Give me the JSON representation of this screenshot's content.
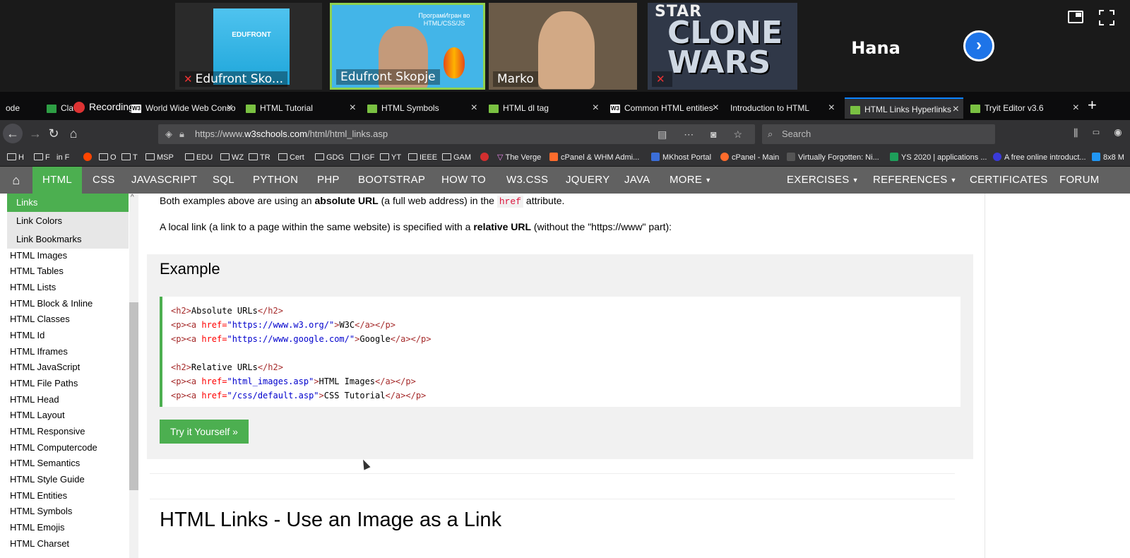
{
  "meeting": {
    "participants": [
      "Edufront Sko...",
      "Edufront Skopje",
      "Marko",
      "",
      "Hana"
    ],
    "tile1_logo": "EDUFRONT",
    "tile2_slide": "ПрограмИгран во HTML/CSS/JS",
    "tile4_star": "STAR",
    "tile4_title": "CLONE WARS",
    "next_icon": "›"
  },
  "tabs": [
    {
      "label": "ode",
      "close": ""
    },
    {
      "label": "Class",
      "close": ""
    },
    {
      "label": "World Wide Web Conso",
      "close": "×"
    },
    {
      "label": "HTML Tutorial",
      "close": "×"
    },
    {
      "label": "HTML Symbols",
      "close": "×"
    },
    {
      "label": "HTML dl tag",
      "close": "×"
    },
    {
      "label": "Common HTML entities",
      "close": "×"
    },
    {
      "label": "Introduction to HTML",
      "close": "×"
    },
    {
      "label": "HTML Links Hyperlinks",
      "close": "×"
    },
    {
      "label": "Tryit Editor v3.6",
      "close": "×"
    }
  ],
  "recording": "Recording",
  "newtab": "+",
  "nav": {
    "url_prefix": "https://www.",
    "url_domain": "w3schools.com",
    "url_path": "/html/html_links.asp",
    "search_placeholder": "Search",
    "url_icons": "▤ ⋯ ◙ ☆",
    "right_icons": "⫼ ▭ ◉"
  },
  "bookmarks": [
    "H",
    "F",
    "in F",
    "",
    "O",
    "T",
    "MSP",
    "EDU",
    "WZ",
    "TR",
    "Cert",
    "GDG",
    "IGF",
    "YT",
    "IEEE",
    "GAM",
    "",
    "The Verge",
    "cPanel & WHM Admi...",
    "MKhost Portal",
    "cPanel - Main",
    "Virtually Forgotten: Ni...",
    "YS 2020 | applications ...",
    "A free online introduct...",
    "8x8 M"
  ],
  "w3nav": [
    "HTML",
    "CSS",
    "JAVASCRIPT",
    "SQL",
    "PYTHON",
    "PHP",
    "BOOTSTRAP",
    "HOW TO",
    "W3.CSS",
    "JQUERY",
    "JAVA",
    "MORE",
    "EXERCISES",
    "REFERENCES",
    "CERTIFICATES",
    "FORUM"
  ],
  "sidebar": {
    "sub": [
      "Links",
      "Link Colors",
      "Link Bookmarks"
    ],
    "items": [
      "HTML Images",
      "HTML Tables",
      "HTML Lists",
      "HTML Block & Inline",
      "HTML Classes",
      "HTML Id",
      "HTML Iframes",
      "HTML JavaScript",
      "HTML File Paths",
      "HTML Head",
      "HTML Layout",
      "HTML Responsive",
      "HTML Computercode",
      "HTML Semantics",
      "HTML Style Guide",
      "HTML Entities",
      "HTML Symbols",
      "HTML Emojis",
      "HTML Charset"
    ]
  },
  "content": {
    "p1_a": "Both examples above are using an ",
    "p1_b": "absolute URL",
    "p1_c": " (a full web address) in the ",
    "p1_code": "href",
    "p1_d": " attribute.",
    "p2_a": "A local link (a link to a page within the same website) is specified with a ",
    "p2_b": "relative URL",
    "p2_c": " (without the \"https://www\" part):",
    "example_title": "Example",
    "code": {
      "l1_open": "<h2>",
      "l1_text": "Absolute URLs",
      "l1_close": "</h2>",
      "l2_url": "\"https://www.w3.org/\"",
      "l2_text": "W3C",
      "l3_url": "\"https://www.google.com/\"",
      "l3_text": "Google",
      "l4_text": "Relative URLs",
      "l5_url": "\"html_images.asp\"",
      "l5_text": "HTML Images",
      "l6_url": "\"/css/default.asp\"",
      "l6_text": "CSS Tutorial"
    },
    "tryit": "Try it Yourself »",
    "heading": "HTML Links - Use an Image as a Link"
  }
}
